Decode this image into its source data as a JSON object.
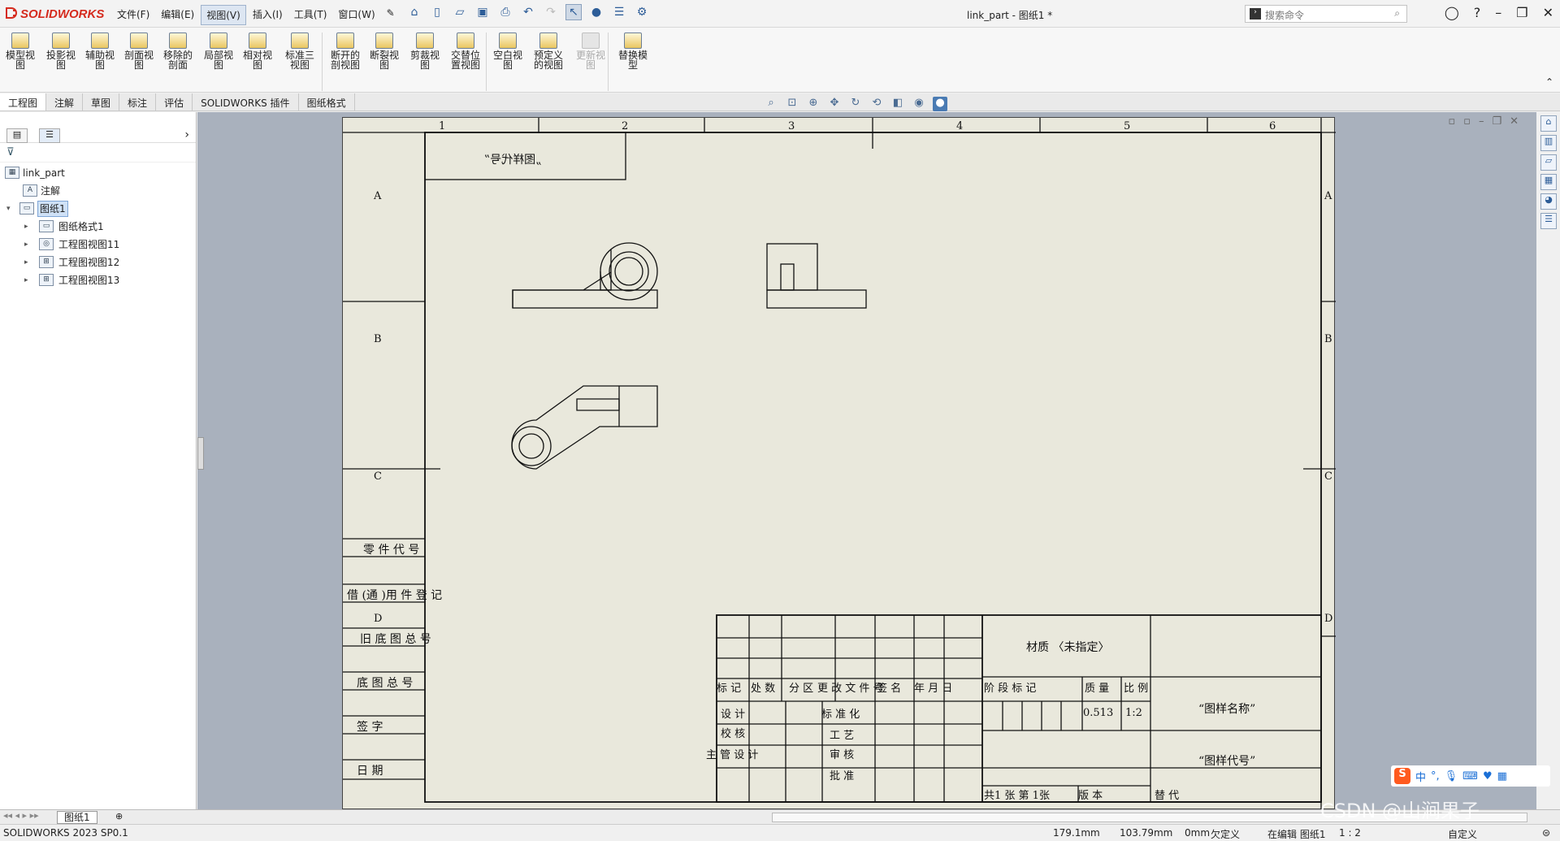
{
  "app": {
    "logo": "SOLIDWORKS",
    "window_title": "link_part - 图纸1 *",
    "search_placeholder": "搜索命令"
  },
  "menu": [
    "文件(F)",
    "编辑(E)",
    "视图(V)",
    "插入(I)",
    "工具(T)",
    "窗口(W)"
  ],
  "ribbon": [
    {
      "label": "模型视图",
      "enabled": true
    },
    {
      "label": "投影视图",
      "enabled": true
    },
    {
      "label": "辅助视图",
      "enabled": true
    },
    {
      "label": "剖面视图",
      "enabled": true
    },
    {
      "label": "移除的剖面",
      "enabled": true
    },
    {
      "label": "局部视图",
      "enabled": true
    },
    {
      "label": "相对视图",
      "enabled": true
    },
    {
      "label": "标准三视图",
      "enabled": true
    },
    {
      "label": "断开的剖视图",
      "enabled": true
    },
    {
      "label": "断裂视图",
      "enabled": true
    },
    {
      "label": "剪裁视图",
      "enabled": true
    },
    {
      "label": "交替位置视图",
      "enabled": true
    },
    {
      "label": "空白视图",
      "enabled": true
    },
    {
      "label": "预定义的视图",
      "enabled": true
    },
    {
      "label": "更新视图",
      "enabled": false
    },
    {
      "label": "替换模型",
      "enabled": true
    }
  ],
  "tabs": [
    "工程图",
    "注解",
    "草图",
    "标注",
    "评估",
    "SOLIDWORKS 插件",
    "图纸格式"
  ],
  "tree": {
    "root": "link_part",
    "items": [
      {
        "label": "注解",
        "level": 1,
        "expand": false
      },
      {
        "label": "图纸1",
        "level": 1,
        "expand": true,
        "selected": true
      },
      {
        "label": "图纸格式1",
        "level": 2,
        "expand": true
      },
      {
        "label": "工程图视图11",
        "level": 2,
        "expand": true
      },
      {
        "label": "工程图视图12",
        "level": 2,
        "expand": true
      },
      {
        "label": "工程图视图13",
        "level": 2,
        "expand": true
      }
    ]
  },
  "drawing": {
    "zone_cols": [
      "1",
      "2",
      "3",
      "4",
      "5",
      "6"
    ],
    "zone_rows": [
      "A",
      "B",
      "C",
      "D"
    ],
    "mirror_label": "„图样代号”",
    "left_labels": [
      "零 件 代 号",
      "借 (通 )用 件 登 记",
      "旧 底 图 总 号",
      "底  图  总  号",
      "签      字",
      "日      期"
    ],
    "title_block": {
      "material": "材质 〈未指定〉",
      "drawing_name": "“图样名称”",
      "drawing_code": "“图样代号”",
      "headers": [
        "标 记",
        "处 数",
        "分 区",
        "更 改 文 件 号",
        "签 名",
        "年  月  日"
      ],
      "stage": "阶  段  标  记",
      "mass_label": "质 量",
      "scale_label": "比 例",
      "mass": "0.513",
      "scale": "1:2",
      "roles_left": [
        "设 计",
        "校 核",
        "主 管 设 计"
      ],
      "roles_right": [
        "标 准 化",
        "工 艺",
        "审 核",
        "批 准"
      ],
      "sheets": "共1 张  第 1张",
      "version": "版 本",
      "replace": "替 代"
    }
  },
  "sheet_tab": "图纸1",
  "status": {
    "version": "SOLIDWORKS 2023 SP0.1",
    "x": "179.1mm",
    "y": "103.79mm",
    "z": "0mm",
    "defined": "欠定义",
    "editing": "在编辑 图纸1",
    "scale": "1 : 2",
    "custom": "自定义"
  },
  "watermark": "CSDN @山涧果子"
}
